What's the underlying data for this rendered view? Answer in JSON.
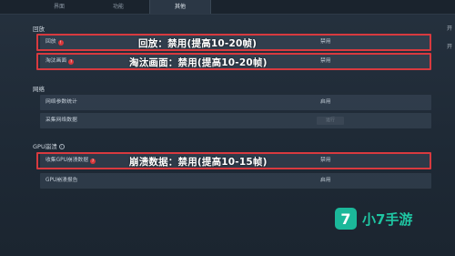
{
  "tabs": [
    "界面",
    "功能",
    "其他"
  ],
  "active_tab_index": 2,
  "sections": {
    "playback": {
      "title": "回放",
      "rows": [
        {
          "label": "回放",
          "badge": "!",
          "value": "禁用"
        },
        {
          "label": "淘汰画面",
          "badge": "?",
          "value": "禁用"
        }
      ]
    },
    "network": {
      "title": "网络",
      "rows": [
        {
          "label": "网络参数统计",
          "value": "启用"
        },
        {
          "label": "采集网络数据",
          "value": "运行"
        }
      ]
    },
    "gpu": {
      "title": "GPU崩溃",
      "info_icon": "i",
      "rows": [
        {
          "label": "收集GPU崩溃数据",
          "badge": "?",
          "value": "禁用"
        },
        {
          "label": "GPU崩溃报告",
          "value": "启用"
        }
      ]
    }
  },
  "annotations": {
    "replay": "回放：禁用(提高10-20帧)",
    "elim": "淘汰画面：禁用(提高10-20帧)",
    "gpu": "崩溃数据：禁用(提高10-15帧)"
  },
  "side_labels": [
    "开",
    "开"
  ],
  "watermark": {
    "logo_char": "7",
    "text": "小7手游",
    "color": "#1fc6a3"
  },
  "colors": {
    "highlight": "#d83a3f",
    "badge": "#d8383a"
  }
}
